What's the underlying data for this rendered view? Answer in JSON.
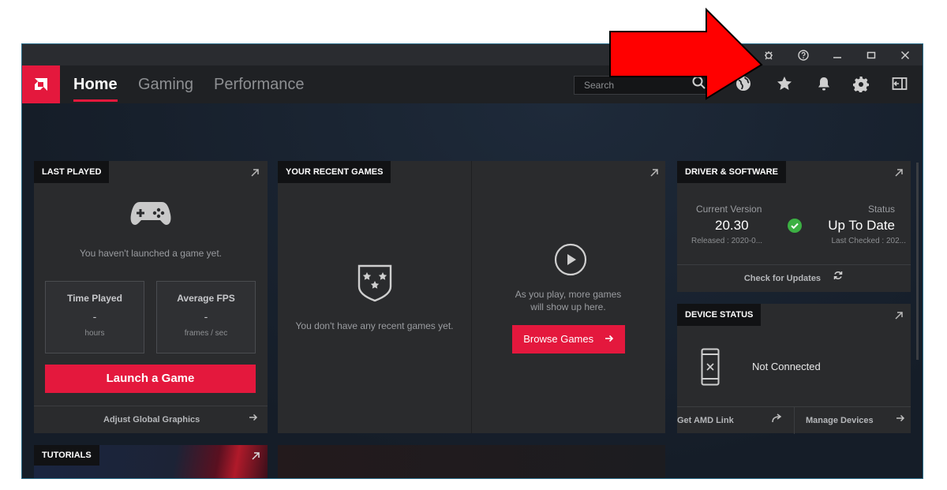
{
  "titlebar": {
    "icons": [
      "bug-icon",
      "help-icon",
      "minimize-icon",
      "maximize-icon",
      "close-icon"
    ]
  },
  "nav": {
    "tabs": [
      {
        "label": "Home",
        "active": true
      },
      {
        "label": "Gaming",
        "active": false
      },
      {
        "label": "Performance",
        "active": false
      }
    ],
    "search_placeholder": "Search",
    "icons": [
      "globe-icon",
      "star-icon",
      "bell-icon",
      "gear-icon",
      "sidebar-toggle-icon"
    ]
  },
  "last_played": {
    "label": "LAST PLAYED",
    "message": "You haven't launched a game yet.",
    "time_played": {
      "title": "Time Played",
      "value": "-",
      "unit": "hours"
    },
    "avg_fps": {
      "title": "Average FPS",
      "value": "-",
      "unit": "frames / sec"
    },
    "launch_button": "Launch a Game",
    "footer": "Adjust Global Graphics"
  },
  "recent_games": {
    "label": "YOUR RECENT GAMES",
    "empty_message": "You don't have any recent games yet.",
    "play_message_line1": "As you play, more games",
    "play_message_line2": "will show up here.",
    "browse_button": "Browse Games"
  },
  "driver": {
    "label": "DRIVER & SOFTWARE",
    "current_version_title": "Current Version",
    "version": "20.30",
    "released": "Released : 2020-0...",
    "status_title": "Status",
    "status": "Up To Date",
    "last_checked": "Last Checked : 202...",
    "check_updates": "Check for Updates"
  },
  "device_status": {
    "label": "DEVICE STATUS",
    "status": "Not Connected",
    "link_left": "Get AMD Link",
    "link_right": "Manage Devices"
  },
  "tutorials": {
    "label": "TUTORIALS"
  },
  "colors": {
    "accent": "#e4183d",
    "success": "#3cb043",
    "annotation_arrow": "#ff0000"
  }
}
